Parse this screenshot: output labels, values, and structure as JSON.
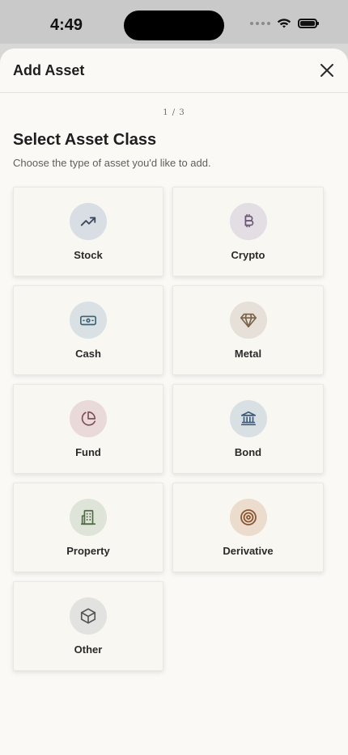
{
  "status": {
    "time": "4:49"
  },
  "sheet": {
    "title": "Add Asset",
    "step": "1 / 3",
    "heading": "Select Asset Class",
    "subheading": "Choose the type of asset you'd like to add."
  },
  "asset_classes": [
    {
      "label": "Stock",
      "icon": "trending-up-icon",
      "color": "#d9dde4"
    },
    {
      "label": "Crypto",
      "icon": "bitcoin-icon",
      "color": "#e3dde4"
    },
    {
      "label": "Cash",
      "icon": "banknote-icon",
      "color": "#d9e1e4"
    },
    {
      "label": "Metal",
      "icon": "gem-icon",
      "color": "#e6e0d8"
    },
    {
      "label": "Fund",
      "icon": "pie-chart-icon",
      "color": "#ead9d9"
    },
    {
      "label": "Bond",
      "icon": "bank-icon",
      "color": "#d9e0e4"
    },
    {
      "label": "Property",
      "icon": "building-icon",
      "color": "#dfe4d8"
    },
    {
      "label": "Derivative",
      "icon": "target-icon",
      "color": "#ebdccd"
    },
    {
      "label": "Other",
      "icon": "box-icon",
      "color": "#e2e2e0"
    }
  ]
}
